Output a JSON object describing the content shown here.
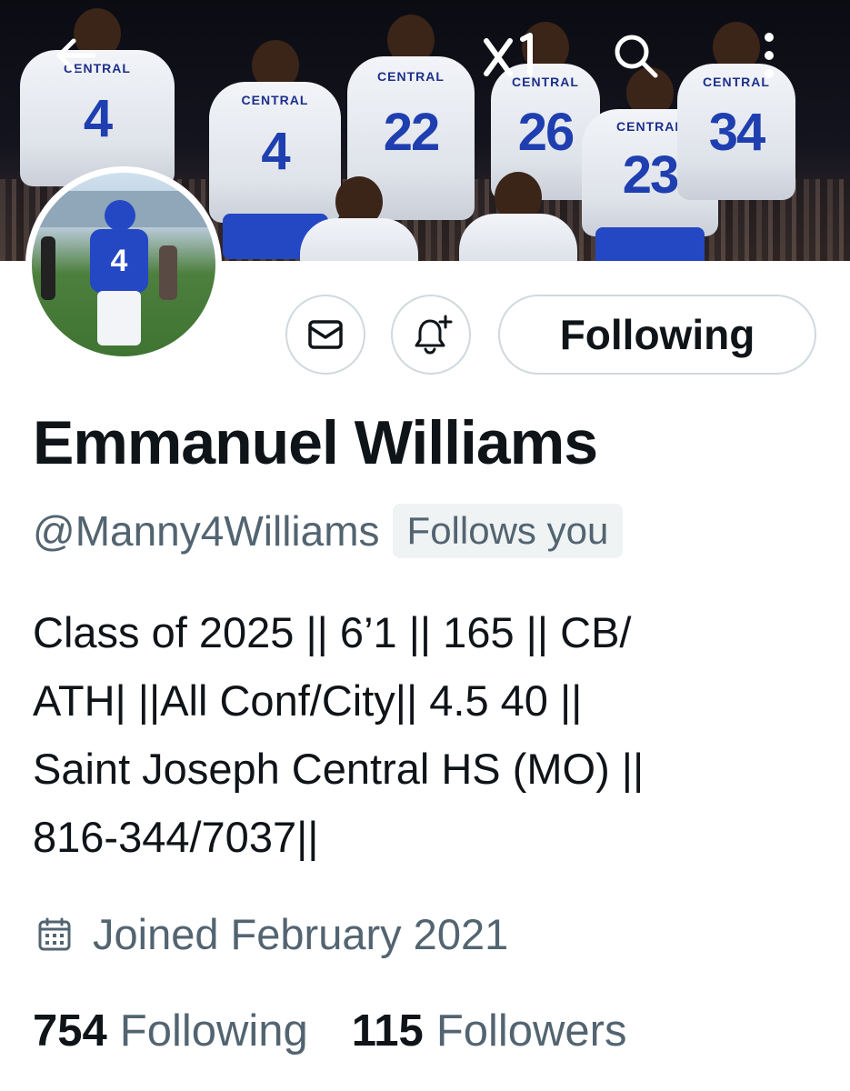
{
  "banner": {
    "jersey_word": "CENTRAL",
    "jersey_numbers": [
      "4",
      "4",
      "22",
      "26",
      "23",
      "34"
    ]
  },
  "top_bar": {
    "icons": [
      "back-arrow-icon",
      "x-logo-icon",
      "search-icon",
      "more-vertical-icon"
    ]
  },
  "avatar": {
    "jersey_number": "4"
  },
  "actions": {
    "message_icon": "envelope-icon",
    "notify_icon": "bell-plus-icon",
    "follow_label": "Following"
  },
  "profile": {
    "name": "Emmanuel Williams",
    "handle": "@Manny4Williams",
    "follows_you": "Follows you",
    "bio_lines": [
      "Class of 2025 || 6’1 || 165 || CB/",
      "ATH| ||All Conf/City|| 4.5 40 ||",
      "Saint Joseph Central HS (MO) ||",
      "816-344/7037||"
    ],
    "joined": "Joined February 2021",
    "joined_icon": "calendar-icon"
  },
  "stats": {
    "following_count": "754",
    "following_label": "Following",
    "followers_count": "115",
    "followers_label": "Followers"
  },
  "colors": {
    "text_primary": "#0f1419",
    "text_secondary": "#536471",
    "border": "#cfd9de",
    "jersey_blue": "#2447c4"
  }
}
